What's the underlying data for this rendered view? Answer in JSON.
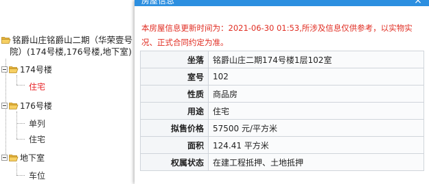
{
  "tree": {
    "root": {
      "label_line1": "铭爵山庄铭爵山二期（华荣壹号",
      "label_line2": "院）(174号楼,176号楼,地下室)"
    },
    "groups": [
      {
        "label": "174号楼",
        "children": [
          "住宅"
        ]
      },
      {
        "label": "176号楼",
        "children": [
          "单列",
          "住宅"
        ]
      },
      {
        "label": "地下室",
        "children": [
          "车位"
        ]
      }
    ]
  },
  "dialog": {
    "title": "房屋信息",
    "close_symbol": "×",
    "notice": "本房屋信息更新时间为：2021-06-30 01:53,所涉及信息仅供参考，以实物实况、正式合同约定为准。",
    "rows": [
      {
        "label": "坐落",
        "value": "铭爵山庄二期174号楼1层102室"
      },
      {
        "label": "室号",
        "value": "102"
      },
      {
        "label": "性质",
        "value": "商品房"
      },
      {
        "label": "用途",
        "value": "住宅"
      },
      {
        "label": "拟售价格",
        "value": "57500 元/平方米"
      },
      {
        "label": "面积",
        "value": "124.41 平方米"
      },
      {
        "label": "权属状态",
        "value": "在建工程抵押、土地抵押"
      }
    ]
  },
  "colors": {
    "accent": "#2c8fe0",
    "notice": "#e02b20",
    "active_leaf": "#e8262a",
    "folder": "#f2c14e"
  }
}
